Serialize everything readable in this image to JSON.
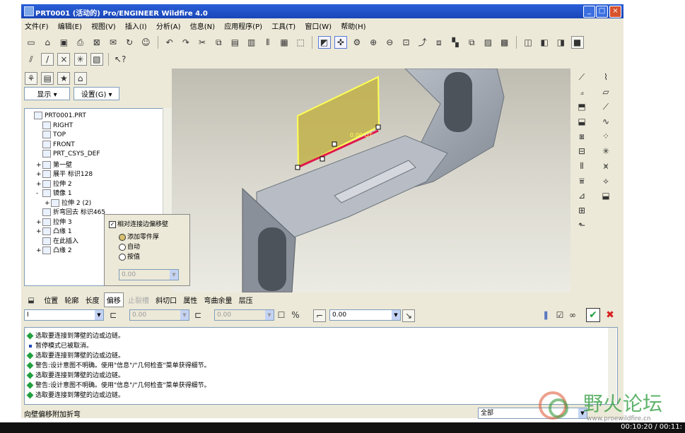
{
  "window": {
    "title": "PRT0001 (活动的)  Pro/ENGINEER Wildfire 4.0"
  },
  "menu": [
    "文件(F)",
    "编辑(E)",
    "视图(V)",
    "插入(I)",
    "分析(A)",
    "信息(N)",
    "应用程序(P)",
    "工具(T)",
    "窗口(W)",
    "帮助(H)"
  ],
  "nav": {
    "show_label": "显示 ▾",
    "settings_label": "设置(G) ▾"
  },
  "tree": [
    {
      "label": "PRT0001.PRT",
      "indent": 0,
      "exp": ""
    },
    {
      "label": "RIGHT",
      "indent": 1,
      "exp": ""
    },
    {
      "label": "TOP",
      "indent": 1,
      "exp": ""
    },
    {
      "label": "FRONT",
      "indent": 1,
      "exp": ""
    },
    {
      "label": "PRT_CSYS_DEF",
      "indent": 1,
      "exp": ""
    },
    {
      "label": "第一壁",
      "indent": 1,
      "exp": "+"
    },
    {
      "label": "展平 标识128",
      "indent": 1,
      "exp": "+"
    },
    {
      "label": "拉伸 2",
      "indent": 1,
      "exp": "+"
    },
    {
      "label": "镜像 1",
      "indent": 1,
      "exp": "-"
    },
    {
      "label": "拉伸 2 (2)",
      "indent": 2,
      "exp": "+"
    },
    {
      "label": "折弯回去 标识465",
      "indent": 1,
      "exp": ""
    },
    {
      "label": "拉伸 3",
      "indent": 1,
      "exp": "+"
    },
    {
      "label": "凸缘 1",
      "indent": 1,
      "exp": "+"
    },
    {
      "label": "在此插入",
      "indent": 1,
      "exp": ""
    },
    {
      "label": "凸缘 2",
      "indent": 1,
      "exp": "+"
    }
  ],
  "popup": {
    "check_label": "相对连接边偏移壁",
    "opt_add": "添加零件厚",
    "opt_auto": "自动",
    "opt_value": "按值",
    "value": "0.00"
  },
  "viewport": {
    "dim_label": "0.00 OT"
  },
  "dash": {
    "tabs": [
      "位置",
      "轮廓",
      "长度",
      "偏移",
      "止裂槽",
      "斜切口",
      "属性",
      "弯曲余量",
      "层压"
    ],
    "active": "偏移",
    "disabled": [
      "止裂槽"
    ],
    "combo1": "I",
    "val1": "0.00",
    "val2": "0.00",
    "thickness": "0.00"
  },
  "messages": [
    {
      "type": "info",
      "text": "选取要连接到薄壁的边或边链。"
    },
    {
      "type": "dot",
      "text": "暂停模式已被取消。"
    },
    {
      "type": "info",
      "text": "选取要连接到薄壁的边或边链。"
    },
    {
      "type": "info",
      "text": "警告:设计意图不明确。使用\"信息\"/\"几何检查\"菜单获得细节。"
    },
    {
      "type": "info",
      "text": "选取要连接到薄壁的边或边链。"
    },
    {
      "type": "info",
      "text": "警告:设计意图不明确。使用\"信息\"/\"几何检查\"菜单获得细节。"
    },
    {
      "type": "info",
      "text": "选取要连接到薄壁的边或边链。"
    }
  ],
  "status": {
    "left": "向壁偏移附加折弯",
    "filter": "全部"
  },
  "watermark": {
    "text": "野火论坛",
    "url": "www.proewildfire.cn"
  },
  "time": "00:10:20 / 00:11:",
  "colors": {
    "title": "#1a46b8",
    "sheet": "#a3a9b0",
    "highlight": "#ffff55"
  }
}
